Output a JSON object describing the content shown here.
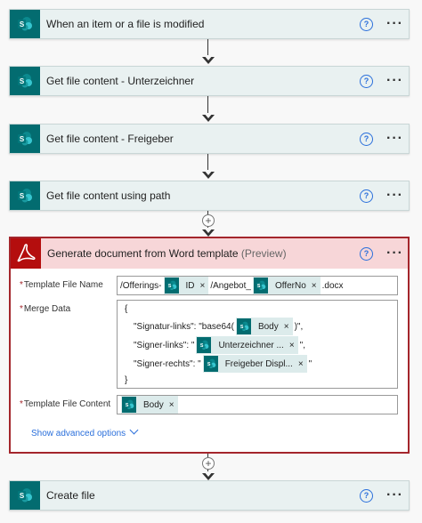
{
  "steps": [
    {
      "title": "When an item or a file is modified",
      "icon": "sharepoint-icon"
    },
    {
      "title": "Get file content - Unterzeichner",
      "icon": "sharepoint-icon"
    },
    {
      "title": "Get file content - Freigeber",
      "icon": "sharepoint-icon"
    },
    {
      "title": "Get file content using path",
      "icon": "sharepoint-icon"
    }
  ],
  "generate": {
    "title": "Generate document from Word template",
    "preview": "(Preview)",
    "icon": "adobe-pdf-icon",
    "fields": {
      "template_file_name": {
        "label": "Template File Name",
        "text1": "/Offerings-",
        "token1": "ID",
        "text2": "/Angebot_",
        "token2": "OfferNo",
        "text3": ".docx"
      },
      "merge_data": {
        "label": "Merge Data",
        "open_brace": "{",
        "line1_text": "\"Signatur-links\": \"base64(",
        "line1_token": "Body",
        "line1_after": ")\",",
        "line2_text": "\"Signer-links\": \"",
        "line2_token": "Unterzeichner ...",
        "line2_after": "\",",
        "line3_text": "\"Signer-rechts\": \"",
        "line3_token": "Freigeber Displ...",
        "line3_after": "\"",
        "close_brace": "}"
      },
      "template_file_content": {
        "label": "Template File Content",
        "token": "Body"
      }
    },
    "advanced_label": "Show advanced options"
  },
  "create_file": {
    "title": "Create file",
    "icon": "sharepoint-icon"
  },
  "help_glyph": "?",
  "more_glyph": "···",
  "remove_glyph": "×",
  "plus_glyph": "+",
  "required_marker": "*",
  "colors": {
    "sharepoint": "#036c70",
    "adobe": "#b40e0e",
    "error_border": "#a4262c",
    "link": "#2a6fdb"
  }
}
